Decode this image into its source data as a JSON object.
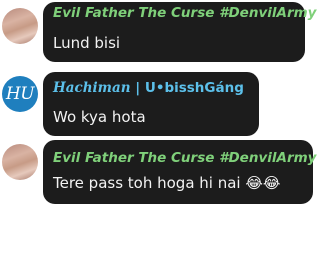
{
  "messages": [
    {
      "sender": "Evil Father The Curse #DenvilArmy",
      "text": "Lund bisi",
      "avatar": "profile-photo"
    },
    {
      "sender_part1": "Hachiman",
      "sender_sep": " | ",
      "sender_part2": "U•bisshGáng",
      "text": "Wo kya hota",
      "avatar_initials": "HU"
    },
    {
      "sender": "Evil Father The Curse #DenvilArmy",
      "text": "Tere pass toh hoga hi nai 😂😂",
      "avatar": "profile-photo"
    }
  ],
  "colors": {
    "bubble": "#1c1c1c",
    "sender_green": "#7fd07a",
    "sender_blue": "#5cc0ea",
    "avatar_blue": "#1f7fbe"
  }
}
